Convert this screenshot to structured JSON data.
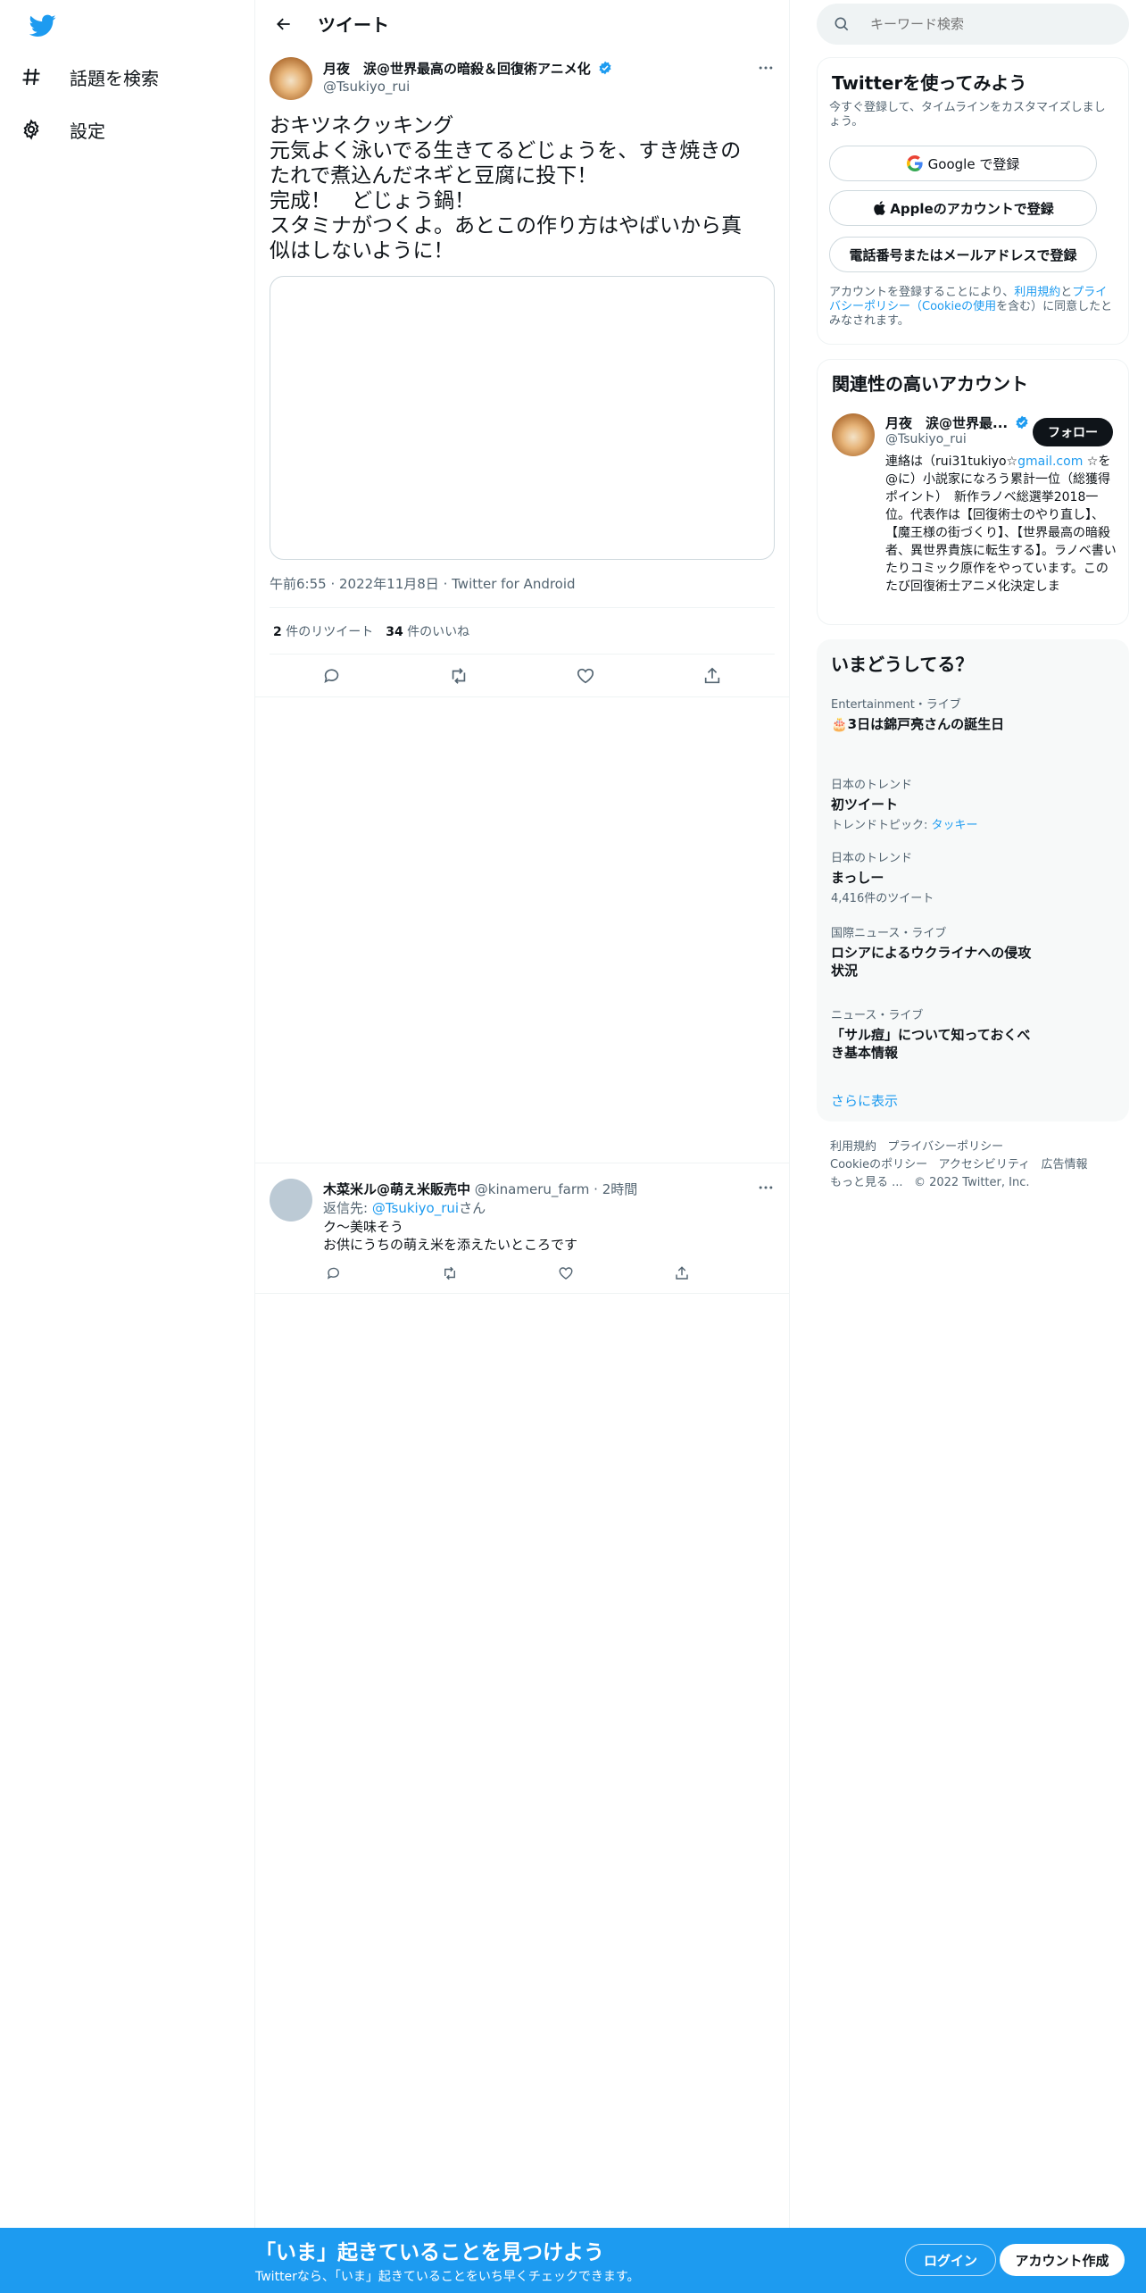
{
  "nav": {
    "items": [
      {
        "label": "話題を検索",
        "icon": "hashtag-icon"
      },
      {
        "label": "設定",
        "icon": "gear-icon"
      }
    ]
  },
  "header": {
    "title": "ツイート"
  },
  "tweet": {
    "author_name": "月夜　涙@世界最高の暗殺＆回復術アニメ化",
    "author_handle": "@Tsukiyo_rui",
    "lines": [
      "おキツネクッキング",
      "元気よく泳いでる生きてるどじょうを、すき焼きの",
      "たれで煮込んだネギと豆腐に投下！",
      "完成！　どじょう鍋！",
      "スタミナがつくよ。あとこの作り方はやばいから真",
      "似はしないように！"
    ],
    "time": "午前6:55",
    "date": "2022年11月8日",
    "source": "Twitter for Android",
    "retweet_count": "2",
    "retweet_label": "件のリツイート",
    "like_count": "34",
    "like_label": "件のいいね"
  },
  "reply": {
    "author_name": "木菜米ル@萌え米販売中",
    "author_handle": "@kinameru_farm",
    "time": "2時間",
    "replying_prefix": "返信先: ",
    "replying_to": "@Tsukiyo_rui",
    "replying_suffix": "さん",
    "lines": [
      "ク〜美味そう",
      "お供にうちの萌え米を添えたいところです"
    ]
  },
  "search": {
    "placeholder": "キーワード検索"
  },
  "signup": {
    "title": "Twitterを使ってみよう",
    "subtitle": "今すぐ登録して、タイムラインをカスタマイズしましょう。",
    "google_label": "Google で登録",
    "apple_label": "Appleのアカウントで登録",
    "phone_label": "電話番号またはメールアドレスで登録",
    "terms_1": "アカウントを登録することにより、",
    "terms_link1": "利用規約",
    "terms_2": "と",
    "terms_link2": "プライバシーポリシー（Cookieの使用",
    "terms_3": "を含む）に同意したとみなされます。"
  },
  "related": {
    "title": "関連性の高いアカウント",
    "name": "月夜　涙@世界最...",
    "handle": "@Tsukiyo_rui",
    "follow_label": "フォロー",
    "bio_1": "連絡は（rui31tukiyo☆",
    "bio_link": "gmail.com",
    "bio_2": " ☆を@に）小説家になろう累計一位（総獲得ポイント）　新作ラノベ総選挙2018一位。代表作は【回復術士のやり直し】、【魔王様の街づくり】、【世界最高の暗殺者、異世界貴族に転生する】。ラノベ書いたりコミック原作をやっています。このたび回復術士アニメ化決定しま"
  },
  "trends": {
    "title": "いまどうしてる？",
    "items": [
      {
        "category": "Entertainment・ライブ",
        "name": "🎂3日は錦戸亮さんの誕生日",
        "sub": ""
      },
      {
        "category": "日本のトレンド",
        "name": "初ツイート",
        "sub": "トレンドトピック: ",
        "sub_link": "タッキー"
      },
      {
        "category": "日本のトレンド",
        "name": "まっしー",
        "sub": "4,416件のツイート"
      },
      {
        "category": "国際ニュース・ライブ",
        "name": "ロシアによるウクライナへの侵攻",
        "name2": "状況",
        "sub": ""
      },
      {
        "category": "ニュース・ライブ",
        "name": "「サル痘」について知っておくべ",
        "name2": "き基本情報",
        "sub": ""
      }
    ],
    "show_more": "さらに表示"
  },
  "footer": {
    "links": [
      "利用規約",
      "プライバシーポリシー",
      "Cookieのポリシー",
      "アクセシビリティ",
      "広告情報",
      "もっと見る ..."
    ],
    "copyright": "© 2022 Twitter, Inc."
  },
  "bottom": {
    "title": "「いま」起きていることを見つけよう",
    "subtitle": "Twitterなら、「いま」起きていることをいち早くチェックできます。",
    "login_label": "ログイン",
    "signup_label": "アカウント作成"
  },
  "colors": {
    "accent": "#1d9bf0",
    "text": "#0f1419",
    "muted": "#536471",
    "border": "#eff3f4"
  }
}
